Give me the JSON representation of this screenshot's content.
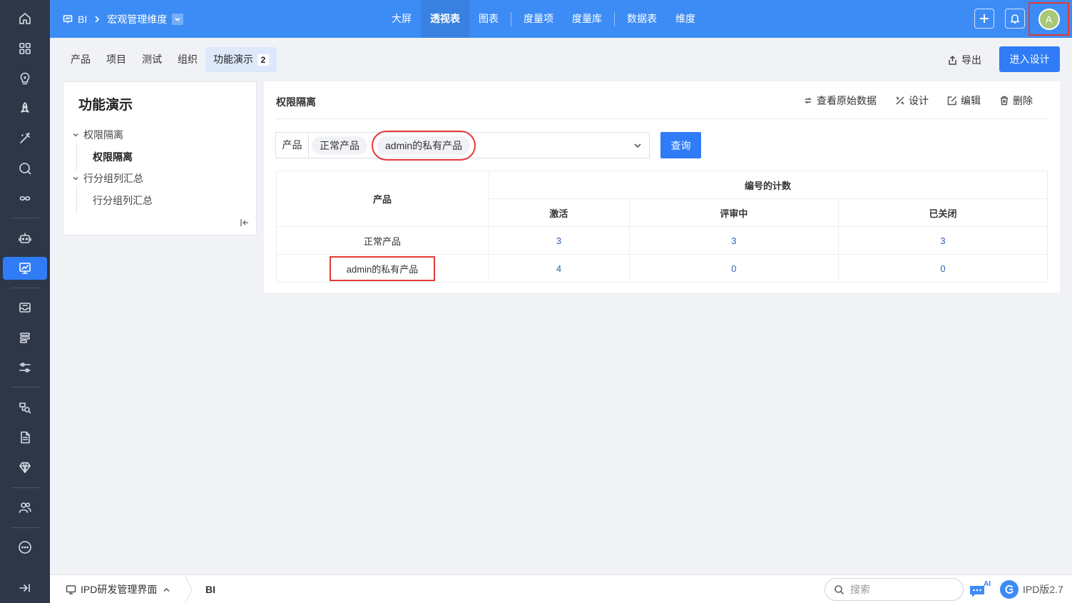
{
  "breadcrumb": {
    "root": "BI",
    "current": "宏观管理维度"
  },
  "topnav": [
    {
      "label": "大屏",
      "active": false
    },
    {
      "label": "透视表",
      "active": true
    },
    {
      "label": "图表",
      "active": false
    },
    {
      "label": "度量项",
      "active": false
    },
    {
      "label": "度量库",
      "active": false
    },
    {
      "label": "数据表",
      "active": false
    },
    {
      "label": "维度",
      "active": false
    }
  ],
  "avatar": {
    "initial": "A"
  },
  "tabs": [
    {
      "label": "产品"
    },
    {
      "label": "项目"
    },
    {
      "label": "测试"
    },
    {
      "label": "组织"
    },
    {
      "label": "功能演示",
      "badge": "2",
      "active": true
    }
  ],
  "toolbar": {
    "export_label": "导出",
    "design_label": "进入设计"
  },
  "left_panel": {
    "title": "功能演示",
    "groups": [
      {
        "label": "权限隔离",
        "children": [
          "权限隔离"
        ]
      },
      {
        "label": "行分组列汇总",
        "children": [
          "行分组列汇总"
        ]
      }
    ]
  },
  "report": {
    "title": "权限隔离",
    "actions": {
      "raw": "查看原始数据",
      "design": "设计",
      "edit": "编辑",
      "delete": "删除"
    },
    "filter": {
      "label": "产品",
      "chips": [
        "正常产品",
        "admin的私有产品"
      ]
    },
    "query_label": "查询",
    "table": {
      "row_header": "产品",
      "group_header": "编号的计数",
      "columns": [
        "激活",
        "评审中",
        "已关闭"
      ],
      "rows": [
        {
          "name": "正常产品",
          "values": [
            "3",
            "3",
            "3"
          ]
        },
        {
          "name": "admin的私有产品",
          "values": [
            "4",
            "0",
            "0"
          ]
        }
      ]
    }
  },
  "footer": {
    "tab_label": "IPD研发管理界面",
    "current": "BI",
    "search_placeholder": "搜索",
    "ai_label": "AI",
    "version": "IPD版2.7"
  },
  "colors": {
    "primary": "#2f7cf6",
    "topbar": "#3d8cf5",
    "rail": "#2e3748",
    "highlight": "#e53935"
  }
}
